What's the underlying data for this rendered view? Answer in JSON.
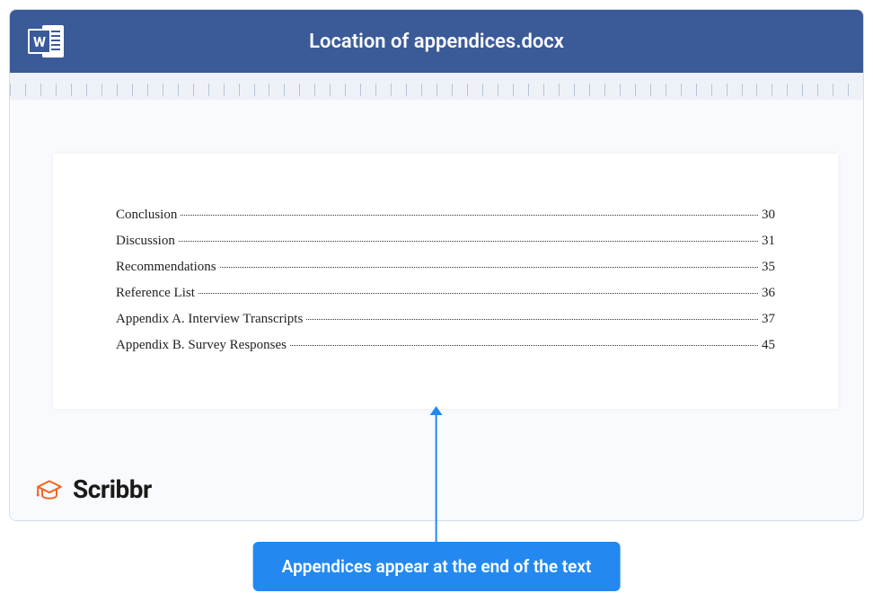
{
  "titlebar": {
    "title": "Location of appendices.docx",
    "icon_letter": "W"
  },
  "toc": {
    "entries": [
      {
        "label": "Conclusion",
        "page": "30"
      },
      {
        "label": "Discussion",
        "page": "31"
      },
      {
        "label": "Recommendations",
        "page": "35"
      },
      {
        "label": "Reference List",
        "page": "36"
      },
      {
        "label": "Appendix A. Interview Transcripts",
        "page": "37"
      },
      {
        "label": "Appendix B. Survey Responses",
        "page": "45"
      }
    ]
  },
  "logo": {
    "text": "Scribbr"
  },
  "callout": {
    "text": "Appendices appear at the end of the text"
  },
  "colors": {
    "titlebar": "#3b5a98",
    "accent": "#2389f0",
    "logo_icon": "#f26522"
  }
}
